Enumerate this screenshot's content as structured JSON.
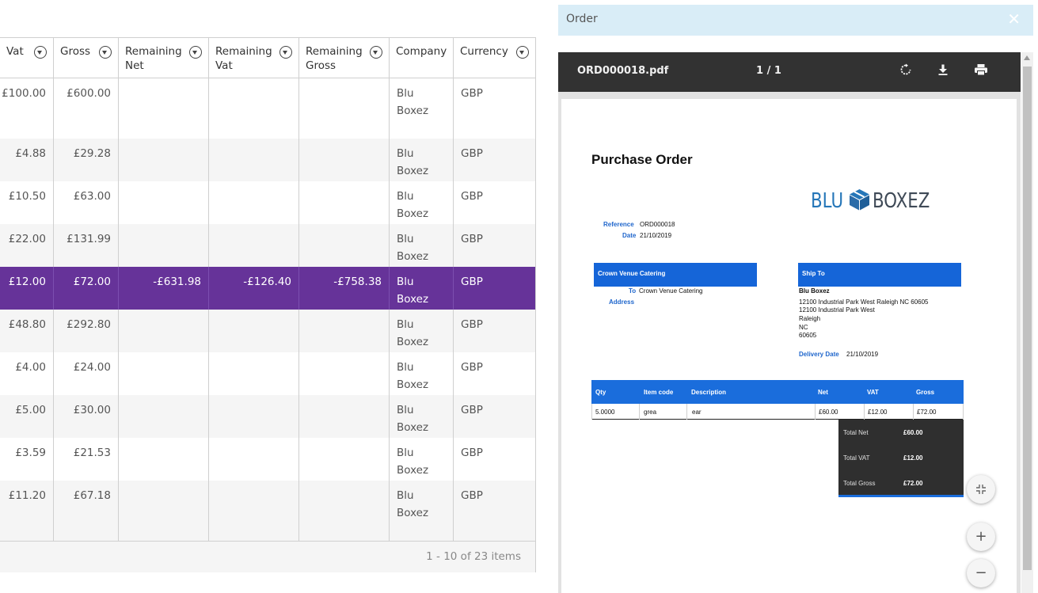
{
  "grid": {
    "columns": [
      {
        "label": "Vat"
      },
      {
        "label": "Gross"
      },
      {
        "label": "Remaining Net"
      },
      {
        "label": "Remaining Vat"
      },
      {
        "label": "Remaining Gross"
      },
      {
        "label": "Company"
      },
      {
        "label": "Currency"
      }
    ],
    "rows": [
      {
        "vat": "£100.00",
        "gross": "£600.00",
        "rem_net": "",
        "rem_vat": "",
        "rem_gross": "",
        "company": "Blu Boxez",
        "currency": "GBP"
      },
      {
        "vat": "£4.88",
        "gross": "£29.28",
        "rem_net": "",
        "rem_vat": "",
        "rem_gross": "",
        "company": "Blu Boxez",
        "currency": "GBP"
      },
      {
        "vat": "£10.50",
        "gross": "£63.00",
        "rem_net": "",
        "rem_vat": "",
        "rem_gross": "",
        "company": "Blu Boxez",
        "currency": "GBP"
      },
      {
        "vat": "£22.00",
        "gross": "£131.99",
        "rem_net": "",
        "rem_vat": "",
        "rem_gross": "",
        "company": "Blu Boxez",
        "currency": "GBP"
      },
      {
        "vat": "£12.00",
        "gross": "£72.00",
        "rem_net": "-£631.98",
        "rem_vat": "-£126.40",
        "rem_gross": "-£758.38",
        "company": "Blu Boxez",
        "currency": "GBP",
        "selected": true
      },
      {
        "vat": "£48.80",
        "gross": "£292.80",
        "rem_net": "",
        "rem_vat": "",
        "rem_gross": "",
        "company": "Blu Boxez",
        "currency": "GBP"
      },
      {
        "vat": "£4.00",
        "gross": "£24.00",
        "rem_net": "",
        "rem_vat": "",
        "rem_gross": "",
        "company": "Blu Boxez",
        "currency": "GBP"
      },
      {
        "vat": "£5.00",
        "gross": "£30.00",
        "rem_net": "",
        "rem_vat": "",
        "rem_gross": "",
        "company": "Blu Boxez",
        "currency": "GBP"
      },
      {
        "vat": "£3.59",
        "gross": "£21.53",
        "rem_net": "",
        "rem_vat": "",
        "rem_gross": "",
        "company": "Blu Boxez",
        "currency": "GBP"
      },
      {
        "vat": "£11.20",
        "gross": "£67.18",
        "rem_net": "",
        "rem_vat": "",
        "rem_gross": "",
        "company": "Blu Boxez",
        "currency": "GBP"
      }
    ],
    "pager_info": "1 - 10 of 23 items",
    "selected_color": "#663399"
  },
  "order_panel": {
    "title": "Order",
    "close_icon": "close-icon"
  },
  "viewer": {
    "file_name": "ORD000018.pdf",
    "page_indicator": "1 / 1",
    "icons": [
      "rotate-icon",
      "download-icon",
      "print-icon"
    ]
  },
  "pdf": {
    "title": "Purchase Order",
    "logo_left": "BLU",
    "logo_right": "BOXEZ",
    "reference_label": "Reference",
    "reference_value": "ORD000018",
    "date_label": "Date",
    "date_value": "21/10/2019",
    "supplier_box": "Crown Venue Catering",
    "to_label": "To",
    "to_value": "Crown Venue Catering",
    "address_label": "Address",
    "shipto_box": "Ship To",
    "shipto_name": "Blu Boxez",
    "shipto_lines": [
      "12100 Industrial Park West Raleigh NC 60605",
      "12100 Industrial Park West",
      "Raleigh",
      "NC",
      "60605"
    ],
    "delivery_label": "Delivery Date",
    "delivery_value": "21/10/2019",
    "item_headers": [
      "Qty",
      "Item code",
      "Description",
      "Net",
      "VAT",
      "Gross"
    ],
    "item_row": [
      "5.0000",
      "grea",
      "ear",
      "£60.00",
      "£12.00",
      "£72.00"
    ],
    "totals": [
      {
        "label": "Total Net",
        "value": "£60.00"
      },
      {
        "label": "Total VAT",
        "value": "£12.00"
      },
      {
        "label": "Total Gross",
        "value": "£72.00"
      }
    ],
    "accent": "#1a6ddc"
  },
  "zoom_controls": {
    "icons": [
      "collapse-icon",
      "zoom-in-icon",
      "zoom-out-icon"
    ]
  }
}
